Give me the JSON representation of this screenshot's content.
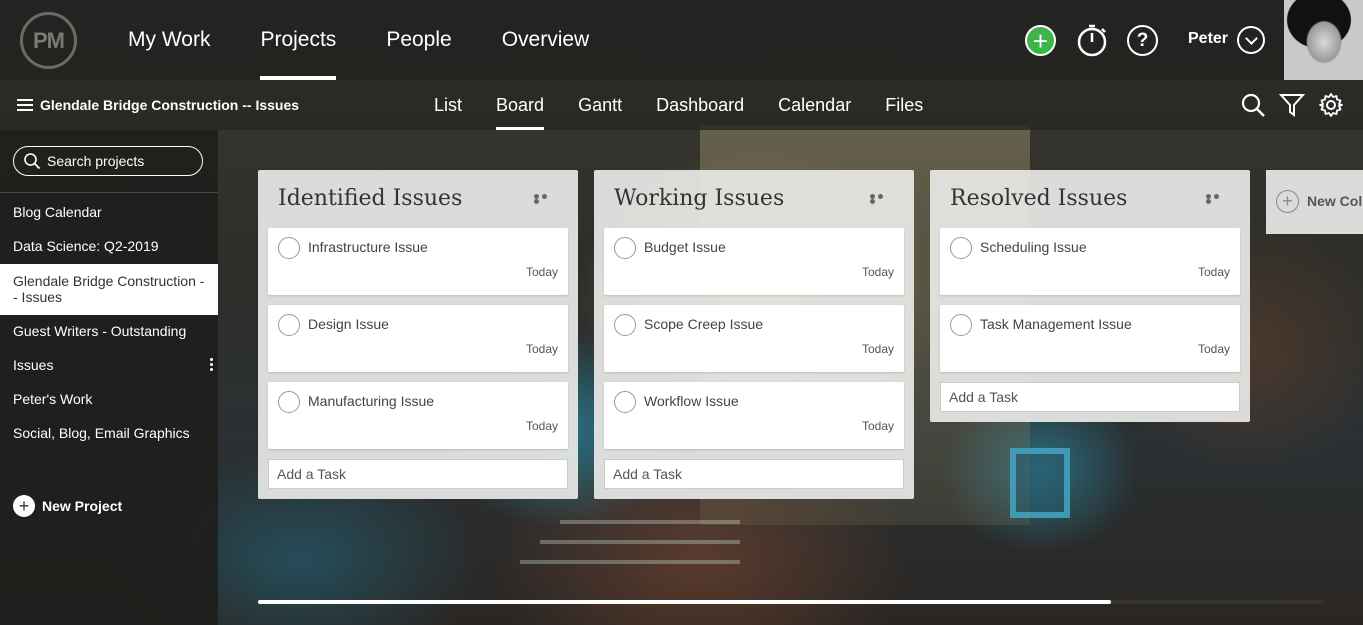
{
  "app": {
    "logo_text": "PM"
  },
  "main_nav": {
    "items": [
      {
        "label": "My Work",
        "active": false
      },
      {
        "label": "Projects",
        "active": true
      },
      {
        "label": "People",
        "active": false
      },
      {
        "label": "Overview",
        "active": false
      }
    ]
  },
  "header": {
    "add_icon": "plus-circle-icon",
    "timer_icon": "stopwatch-icon",
    "help_label": "?",
    "user_name": "Peter"
  },
  "subbar": {
    "project_title": "Glendale Bridge Construction -- Issues",
    "tabs": [
      {
        "label": "List",
        "active": false
      },
      {
        "label": "Board",
        "active": true
      },
      {
        "label": "Gantt",
        "active": false
      },
      {
        "label": "Dashboard",
        "active": false
      },
      {
        "label": "Calendar",
        "active": false
      },
      {
        "label": "Files",
        "active": false
      }
    ]
  },
  "sidebar": {
    "search_placeholder": "Search projects",
    "projects": [
      {
        "label": "Blog Calendar"
      },
      {
        "label": "Data Science: Q2-2019"
      },
      {
        "label": "Glendale Bridge Construction -- Issues",
        "active": true
      },
      {
        "label": "Guest Writers - Outstanding"
      },
      {
        "label": "Issues"
      },
      {
        "label": "Peter's Work"
      },
      {
        "label": "Social, Blog, Email Graphics"
      }
    ],
    "new_project_label": "New Project"
  },
  "board": {
    "columns": [
      {
        "title": "Identified Issues",
        "tasks": [
          {
            "name": "Infrastructure Issue",
            "due": "Today"
          },
          {
            "name": "Design Issue",
            "due": "Today"
          },
          {
            "name": "Manufacturing Issue",
            "due": "Today"
          }
        ],
        "add_task_label": "Add a Task"
      },
      {
        "title": "Working Issues",
        "tasks": [
          {
            "name": "Budget Issue",
            "due": "Today"
          },
          {
            "name": "Scope Creep Issue",
            "due": "Today"
          },
          {
            "name": "Workflow Issue",
            "due": "Today"
          }
        ],
        "add_task_label": "Add a Task"
      },
      {
        "title": "Resolved Issues",
        "tasks": [
          {
            "name": "Scheduling Issue",
            "due": "Today"
          },
          {
            "name": "Task Management Issue",
            "due": "Today"
          }
        ],
        "add_task_label": "Add a Task"
      }
    ],
    "new_column_label": "New Colu",
    "scroll_fraction": 0.8
  },
  "colors": {
    "accent_green": "#3cb54a",
    "topbar": "#222220",
    "column_bg": "#e8e8e6"
  }
}
